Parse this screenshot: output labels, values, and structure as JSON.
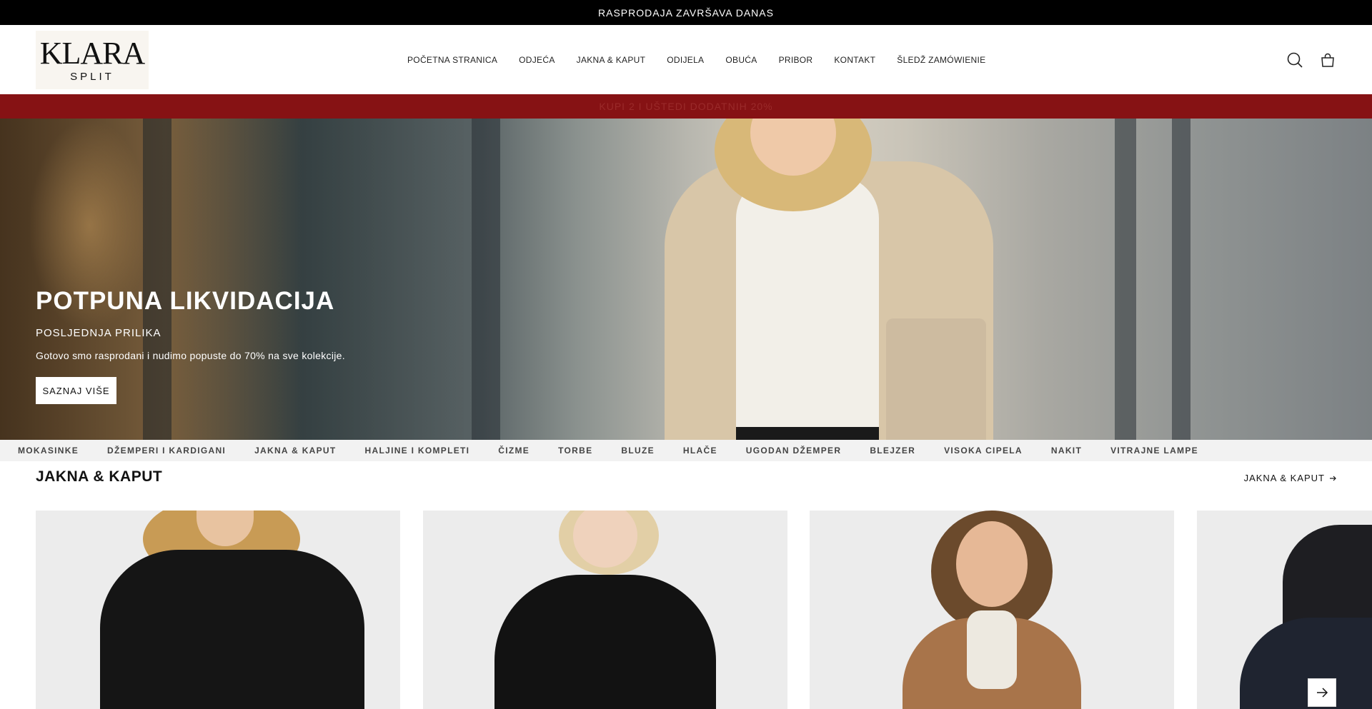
{
  "announcement": "RASPRODAJA ZAVRŠAVA DANAS",
  "logo": {
    "main": "KLARA",
    "sub": "SPLIT"
  },
  "nav": [
    "POČETNA STRANICA",
    "ODJEĆA",
    "JAKNA & KAPUT",
    "ODIJELA",
    "OBUĆA",
    "PRIBOR",
    "KONTAKT",
    "ŠLEDŽ ZAMÓWIENIE"
  ],
  "icons": {
    "search": "search-icon",
    "cart": "cart-icon"
  },
  "promo_bar": "KUPI 2 I UŠTEDI DODATNIH 20%",
  "hero": {
    "title": "POTPUNA LIKVIDACIJA",
    "subtitle": "POSLJEDNJA PRILIKA",
    "text": "Gotovo smo rasprodani i nudimo popuste do 70% na sve kolekcije.",
    "button": "SAZNAJ VIŠE"
  },
  "categories": [
    "MOKASINKE",
    "DŽEMPERI I KARDIGANI",
    "JAKNA & KAPUT",
    "HALJINE I KOMPLETI",
    "ČIZME",
    "TORBE",
    "BLUZE",
    "HLAČE",
    "UGODAN DŽEMPER",
    "BLEJZER",
    "VISOKA CIPELA",
    "NAKIT",
    "VITRAJNE LAMPE"
  ],
  "section": {
    "title": "JAKNA & KAPUT",
    "link": "JAKNA & KAPUT"
  },
  "colors": {
    "announcement_bg": "#000000",
    "promo_bg": "#861214",
    "accent": "#121212"
  }
}
